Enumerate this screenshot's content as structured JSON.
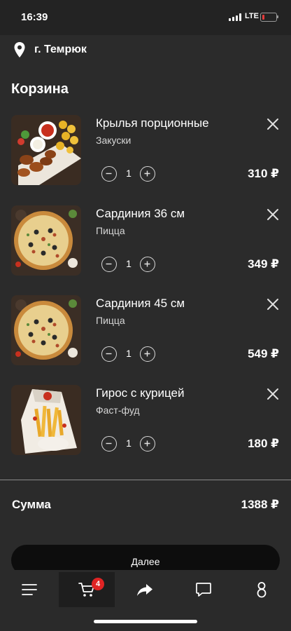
{
  "status_bar": {
    "time": "16:39",
    "network": "LTE",
    "battery_color": "#e63a3a"
  },
  "location": {
    "icon": "map-pin-icon",
    "city": "г. Темрюк"
  },
  "page": {
    "title": "Корзина"
  },
  "cart": {
    "items": [
      {
        "name": "Крылья порционные",
        "category": "Закуски",
        "quantity": "1",
        "price": "310 ₽",
        "image": "chicken-wings-image"
      },
      {
        "name": "Сардиния 36 см",
        "category": "Пицца",
        "quantity": "1",
        "price": "349 ₽",
        "image": "pizza-image"
      },
      {
        "name": "Сардиния 45 см",
        "category": "Пицца",
        "quantity": "1",
        "price": "549 ₽",
        "image": "pizza-image"
      },
      {
        "name": "Гирос с курицей",
        "category": "Фаст-фуд",
        "quantity": "1",
        "price": "180 ₽",
        "image": "gyros-image"
      }
    ],
    "total_label": "Сумма",
    "total_value": "1388 ₽",
    "next_label": "Далее"
  },
  "tabbar": {
    "items": [
      {
        "icon": "menu-icon"
      },
      {
        "icon": "cart-icon",
        "badge": "4",
        "active": true
      },
      {
        "icon": "share-icon"
      },
      {
        "icon": "chat-icon"
      },
      {
        "icon": "profile-icon"
      }
    ]
  },
  "colors": {
    "background": "#2b2b2b",
    "badge": "#e02424",
    "button": "#0d0d0d"
  }
}
